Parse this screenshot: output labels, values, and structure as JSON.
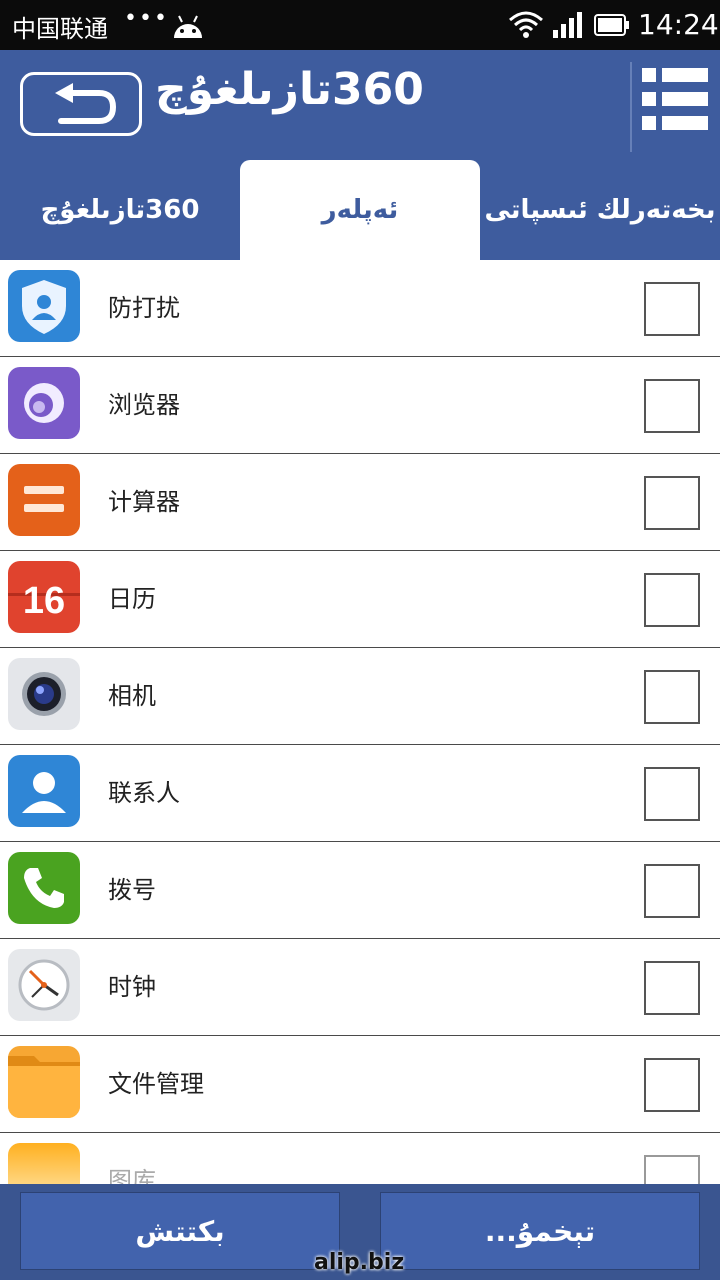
{
  "status_bar": {
    "carrier": "中国联通",
    "dots": "•••",
    "time": "14:24"
  },
  "header": {
    "title": "360تازىلغۇچ",
    "tabs": [
      {
        "label": "360تازىلغۇچ"
      },
      {
        "label": "ئەپلەر"
      },
      {
        "label": "بخەتەرلك ئىسپاتى"
      }
    ]
  },
  "apps": [
    {
      "label": "防打扰",
      "icon": "shield-user-icon"
    },
    {
      "label": "浏览器",
      "icon": "browser-icon"
    },
    {
      "label": "计算器",
      "icon": "calculator-icon"
    },
    {
      "label": "日历",
      "icon": "calendar-icon",
      "icon_text": "16"
    },
    {
      "label": "相机",
      "icon": "camera-icon"
    },
    {
      "label": "联系人",
      "icon": "contacts-icon"
    },
    {
      "label": "拨号",
      "icon": "phone-icon"
    },
    {
      "label": "时钟",
      "icon": "clock-icon"
    },
    {
      "label": "文件管理",
      "icon": "folder-icon"
    },
    {
      "label": "图库",
      "icon": "gallery-icon"
    }
  ],
  "bottom_bar": {
    "left_button": "بكتتش",
    "right_button": "تېخمۇ..."
  },
  "watermark": "alip.biz",
  "colors": {
    "header": "#3e5c9e",
    "button": "#4263ad",
    "status_bar": "#0b0b0b"
  }
}
